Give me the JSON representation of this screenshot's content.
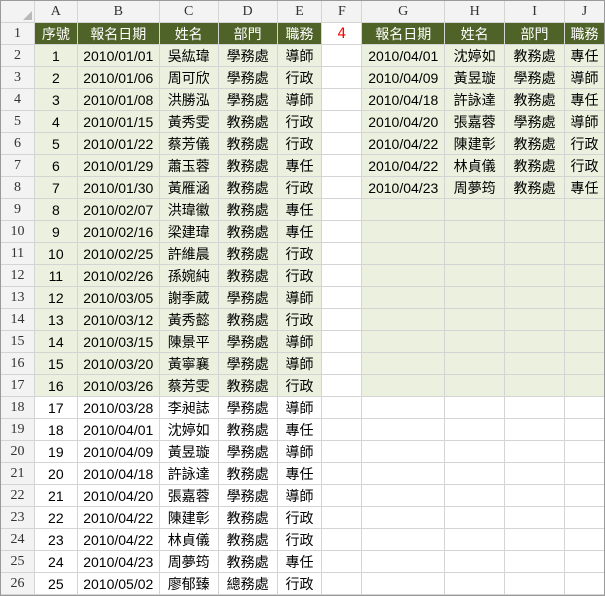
{
  "sheet": {
    "columns": [
      "A",
      "B",
      "C",
      "D",
      "E",
      "F",
      "G",
      "H",
      "I",
      "J"
    ],
    "headers": {
      "left": [
        "序號",
        "報名日期",
        "姓名",
        "部門",
        "職務"
      ],
      "F": "4",
      "right": [
        "報名日期",
        "姓名",
        "部門",
        "職務"
      ]
    },
    "rows": [
      {
        "n": "2",
        "d": "2010/01/01",
        "name": "吳紘瑋",
        "dept": "學務處",
        "role": "導師"
      },
      {
        "n": "3",
        "d": "2010/01/06",
        "name": "周可欣",
        "dept": "學務處",
        "role": "行政"
      },
      {
        "n": "4",
        "d": "2010/01/08",
        "name": "洪勝泓",
        "dept": "學務處",
        "role": "導師"
      },
      {
        "n": "5",
        "d": "2010/01/15",
        "name": "黃秀雯",
        "dept": "教務處",
        "role": "行政"
      },
      {
        "n": "6",
        "d": "2010/01/22",
        "name": "蔡芳儀",
        "dept": "教務處",
        "role": "行政"
      },
      {
        "n": "7",
        "d": "2010/01/29",
        "name": "蕭玉蓉",
        "dept": "教務處",
        "role": "專任"
      },
      {
        "n": "8",
        "d": "2010/01/30",
        "name": "黃雁涵",
        "dept": "教務處",
        "role": "行政"
      },
      {
        "n": "9",
        "d": "2010/02/07",
        "name": "洪瑋徽",
        "dept": "教務處",
        "role": "專任"
      },
      {
        "n": "10",
        "d": "2010/02/16",
        "name": "梁建瑋",
        "dept": "教務處",
        "role": "專任"
      },
      {
        "n": "11",
        "d": "2010/02/25",
        "name": "許維晨",
        "dept": "教務處",
        "role": "行政"
      },
      {
        "n": "12",
        "d": "2010/02/26",
        "name": "孫婉純",
        "dept": "教務處",
        "role": "行政"
      },
      {
        "n": "13",
        "d": "2010/03/05",
        "name": "謝季葳",
        "dept": "學務處",
        "role": "導師"
      },
      {
        "n": "14",
        "d": "2010/03/12",
        "name": "黃秀懿",
        "dept": "教務處",
        "role": "行政"
      },
      {
        "n": "15",
        "d": "2010/03/15",
        "name": "陳景平",
        "dept": "學務處",
        "role": "導師"
      },
      {
        "n": "16",
        "d": "2010/03/20",
        "name": "黃寧襄",
        "dept": "學務處",
        "role": "導師"
      },
      {
        "n": "17",
        "d": "2010/03/26",
        "name": "蔡芳雯",
        "dept": "教務處",
        "role": "行政"
      },
      {
        "n": "18",
        "d": "2010/03/28",
        "name": "李昶誌",
        "dept": "學務處",
        "role": "導師"
      },
      {
        "n": "19",
        "d": "2010/04/01",
        "name": "沈婷如",
        "dept": "教務處",
        "role": "專任"
      },
      {
        "n": "20",
        "d": "2010/04/09",
        "name": "黃昱璇",
        "dept": "學務處",
        "role": "導師"
      },
      {
        "n": "21",
        "d": "2010/04/18",
        "name": "許詠達",
        "dept": "教務處",
        "role": "專任"
      },
      {
        "n": "22",
        "d": "2010/04/20",
        "name": "張嘉蓉",
        "dept": "學務處",
        "role": "導師"
      },
      {
        "n": "23",
        "d": "2010/04/22",
        "name": "陳建彰",
        "dept": "教務處",
        "role": "行政"
      },
      {
        "n": "24",
        "d": "2010/04/22",
        "name": "林貞儀",
        "dept": "教務處",
        "role": "行政"
      },
      {
        "n": "25",
        "d": "2010/04/23",
        "name": "周夢筠",
        "dept": "教務處",
        "role": "專任"
      },
      {
        "n": "26",
        "d": "2010/05/02",
        "name": "廖郁臻",
        "dept": "總務處",
        "role": "行政"
      }
    ],
    "seq": [
      "1",
      "2",
      "3",
      "4",
      "5",
      "6",
      "7",
      "8",
      "9",
      "10",
      "11",
      "12",
      "13",
      "14",
      "15",
      "16",
      "17",
      "18",
      "19",
      "20",
      "21",
      "22",
      "23",
      "24",
      "25"
    ],
    "right_rows": [
      {
        "d": "2010/04/01",
        "name": "沈婷如",
        "dept": "教務處",
        "role": "專任"
      },
      {
        "d": "2010/04/09",
        "name": "黃昱璇",
        "dept": "學務處",
        "role": "導師"
      },
      {
        "d": "2010/04/18",
        "name": "許詠達",
        "dept": "教務處",
        "role": "專任"
      },
      {
        "d": "2010/04/20",
        "name": "張嘉蓉",
        "dept": "學務處",
        "role": "導師"
      },
      {
        "d": "2010/04/22",
        "name": "陳建彰",
        "dept": "教務處",
        "role": "行政"
      },
      {
        "d": "2010/04/22",
        "name": "林貞儀",
        "dept": "教務處",
        "role": "行政"
      },
      {
        "d": "2010/04/23",
        "name": "周夢筠",
        "dept": "教務處",
        "role": "專任"
      }
    ],
    "row_header_1": "1"
  }
}
